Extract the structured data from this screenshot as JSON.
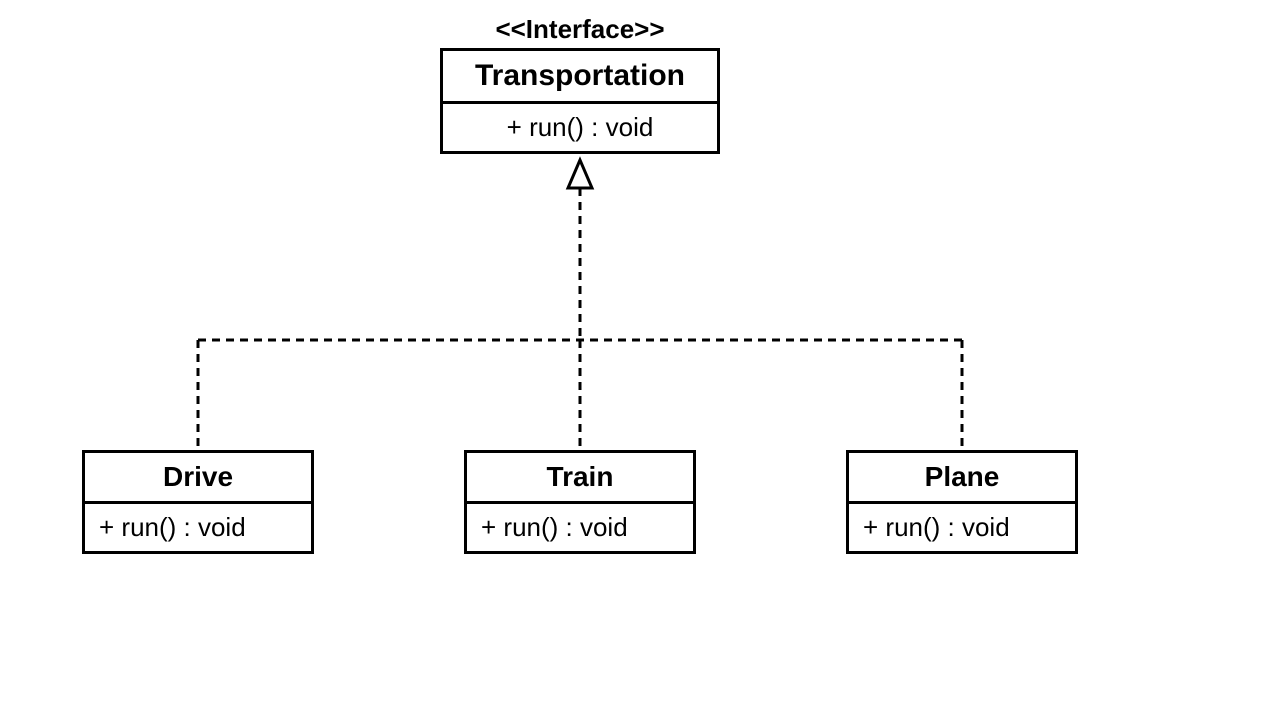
{
  "diagram": {
    "type": "uml-class",
    "stereotype": "<<Interface>>",
    "interface": {
      "name": "Transportation",
      "methods": [
        "+ run() : void"
      ]
    },
    "implementations": [
      {
        "name": "Drive",
        "methods": [
          "+ run() : void"
        ]
      },
      {
        "name": "Train",
        "methods": [
          "+ run() : void"
        ]
      },
      {
        "name": "Plane",
        "methods": [
          "+ run() : void"
        ]
      }
    ],
    "relationship": "realization"
  }
}
